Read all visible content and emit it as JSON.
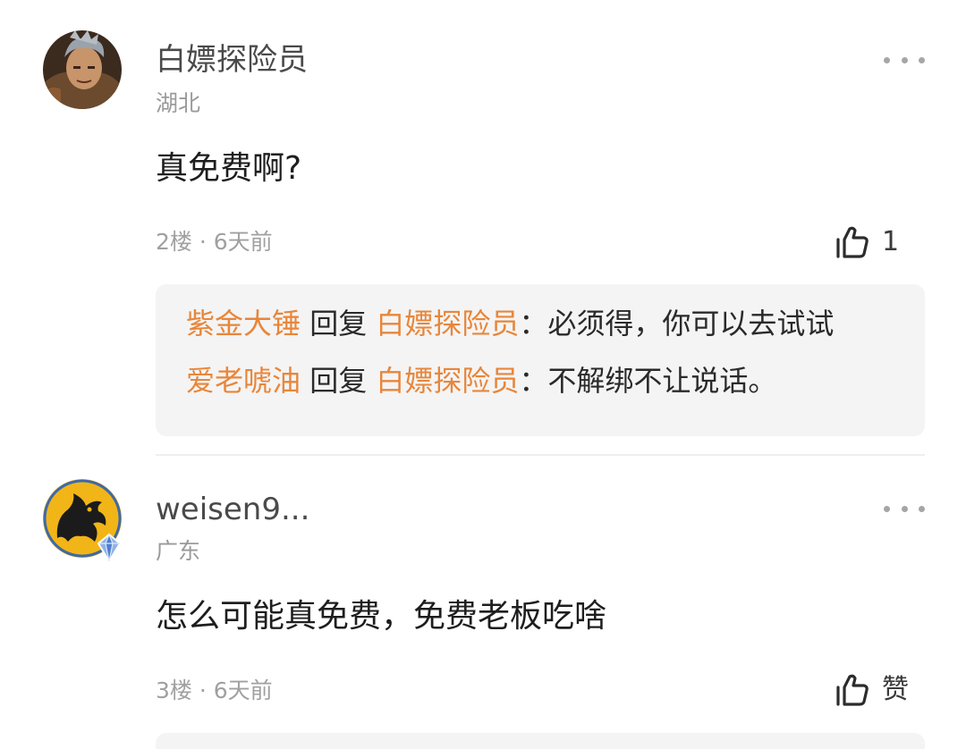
{
  "comments": [
    {
      "username": "白嫖探险员",
      "location": "湖北",
      "text": "真免费啊?",
      "floor": "2楼",
      "separator": " · ",
      "time": "6天前",
      "likes": "1",
      "replies": [
        {
          "from": "紫金大锤",
          "verb": " 回复 ",
          "to": "白嫖探险员",
          "colon": "：",
          "text": "必须得，你可以去试试"
        },
        {
          "from": "爱老唬油",
          "verb": " 回复 ",
          "to": "白嫖探险员",
          "colon": "：",
          "text": "不解绑不让说话。"
        }
      ]
    },
    {
      "username": "weisen9...",
      "location": "广东",
      "text": "怎么可能真免费，免费老板吃啥",
      "floor": "3楼",
      "separator": " · ",
      "time": "6天前",
      "likes": "赞"
    }
  ],
  "colors": {
    "accent": "#e8863a",
    "reply_bg": "#f4f4f4",
    "meta": "#a0a0a0"
  },
  "icons": {
    "more": "more-dots-icon",
    "like": "thumbs-up-icon",
    "badge": "crystal-badge-icon"
  }
}
